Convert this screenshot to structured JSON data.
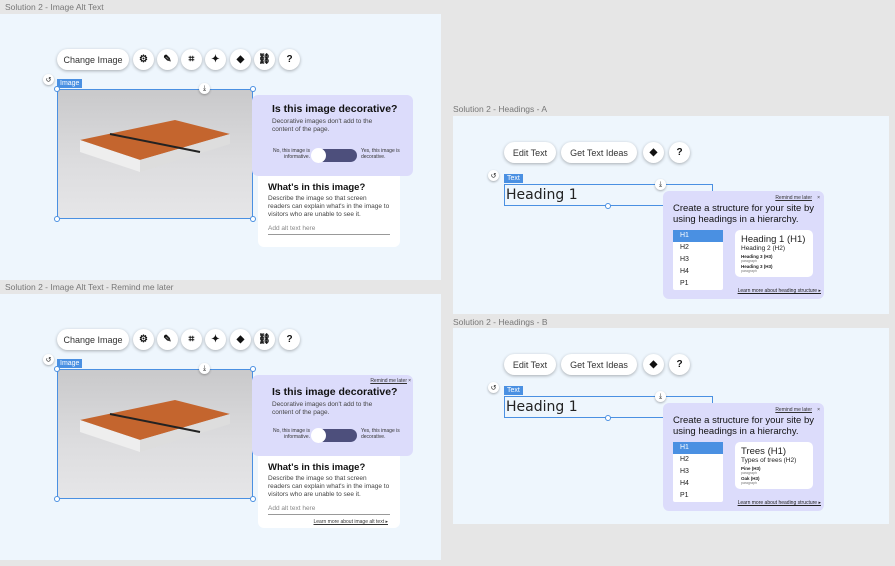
{
  "frames": [
    {
      "label": "Solution 2 - Image Alt Text"
    },
    {
      "label": "Solution 2 - Image Alt Text - Remind me later"
    },
    {
      "label": "Solution 2 - Headings - A"
    },
    {
      "label": "Solution 2 - Headings - B"
    }
  ],
  "image_toolbar": {
    "change_image": "Change Image",
    "icons": [
      "gear-icon",
      "pen-icon",
      "crop-icon",
      "magic-wand-icon",
      "animation-icon",
      "link-icon",
      "help-icon"
    ]
  },
  "image_tag": "Image",
  "alt": {
    "decorative_title": "Is this image decorative?",
    "decorative_desc": "Decorative images don't add to the content of the page.",
    "no_label": "No, this image is informative.",
    "yes_label": "Yes, this image is decorative.",
    "whats_title": "What's in this image?",
    "whats_desc": "Describe the image so that screen readers can explain what's in the image to visitors who are unable to see it.",
    "placeholder": "Add alt text here",
    "remind": "Remind me later",
    "close": "×",
    "learn_more": "Learn more about image alt text ▸"
  },
  "text_toolbar": {
    "edit_text": "Edit Text",
    "get_text_ideas": "Get Text Ideas"
  },
  "text_tag": "Text",
  "heading_text": "Heading 1",
  "headings": {
    "remind": "Remind me later",
    "close": "×",
    "title": "Create a structure for your site by using headings in a hierarchy.",
    "levels": [
      "H1",
      "H2",
      "H3",
      "H4",
      "P1"
    ],
    "learn_more": "Learn more about heading structure ▸",
    "preview_a": {
      "h1": "Heading 1 (H1)",
      "h2": "Heading 2 (H2)",
      "h3a": "Heading 3 (H3)",
      "pa": "paragraph",
      "h3b": "Heading 3 (H3)",
      "pb": "paragraph"
    },
    "preview_b": {
      "h1": "Trees (H1)",
      "h2": "Types of trees (H2)",
      "h3a": "Pine (H3)",
      "pa": "paragraph",
      "h3b": "Oak (H3)",
      "pb": "paragraph"
    }
  }
}
